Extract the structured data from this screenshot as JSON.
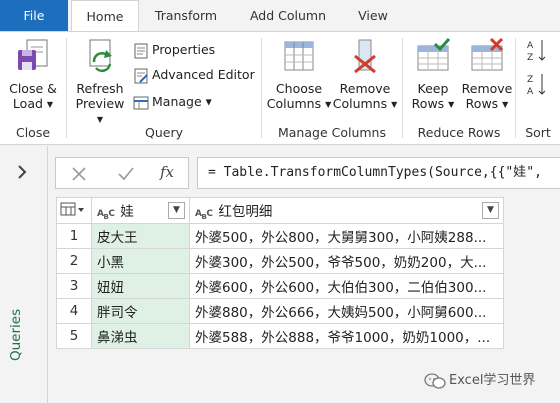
{
  "tabs": [
    "File",
    "Home",
    "Transform",
    "Add Column",
    "View"
  ],
  "ribbon": {
    "close": {
      "btn": "Close &\nLoad",
      "line1": "Close &",
      "line2": "Load",
      "label": "Close"
    },
    "query": {
      "refresh_line1": "Refresh",
      "refresh_line2": "Preview",
      "properties": "Properties",
      "advanced_editor": "Advanced Editor",
      "manage": "Manage",
      "label": "Query"
    },
    "manage_columns": {
      "choose_line1": "Choose",
      "choose_line2": "Columns",
      "remove_line1": "Remove",
      "remove_line2": "Columns",
      "label": "Manage Columns"
    },
    "reduce_rows": {
      "keep_line1": "Keep",
      "keep_line2": "Rows",
      "remove_line1": "Remove",
      "remove_line2": "Rows",
      "label": "Reduce Rows"
    },
    "sort": {
      "label": "Sort"
    }
  },
  "queries_pane": {
    "label": "Queries"
  },
  "formula_bar": {
    "fx": "fx",
    "formula": "= Table.TransformColumnTypes(Source,{{\"娃\","
  },
  "grid": {
    "columns": [
      "娃",
      "红包明细"
    ],
    "type_label": "ABC",
    "rows": [
      {
        "num": "1",
        "name": "皮大王",
        "detail": "外婆500，外公800，大舅舅300，小阿姨288..."
      },
      {
        "num": "2",
        "name": "小黑",
        "detail": "外婆300，外公500，爷爷500，奶奶200，大..."
      },
      {
        "num": "3",
        "name": "妞妞",
        "detail": "外婆600，外公600，大伯伯300，二伯伯300..."
      },
      {
        "num": "4",
        "name": "胖司令",
        "detail": "外婆880，外公666，大姨妈500，小阿舅600..."
      },
      {
        "num": "5",
        "name": "鼻涕虫",
        "detail": "外婆588，外公888，爷爷1000，奶奶1000，..."
      }
    ]
  },
  "watermark": "Excel学习世界",
  "colors": {
    "accent": "#217346",
    "file_tab": "#1d6fbd",
    "name_column_bg": "#dff0e5"
  }
}
